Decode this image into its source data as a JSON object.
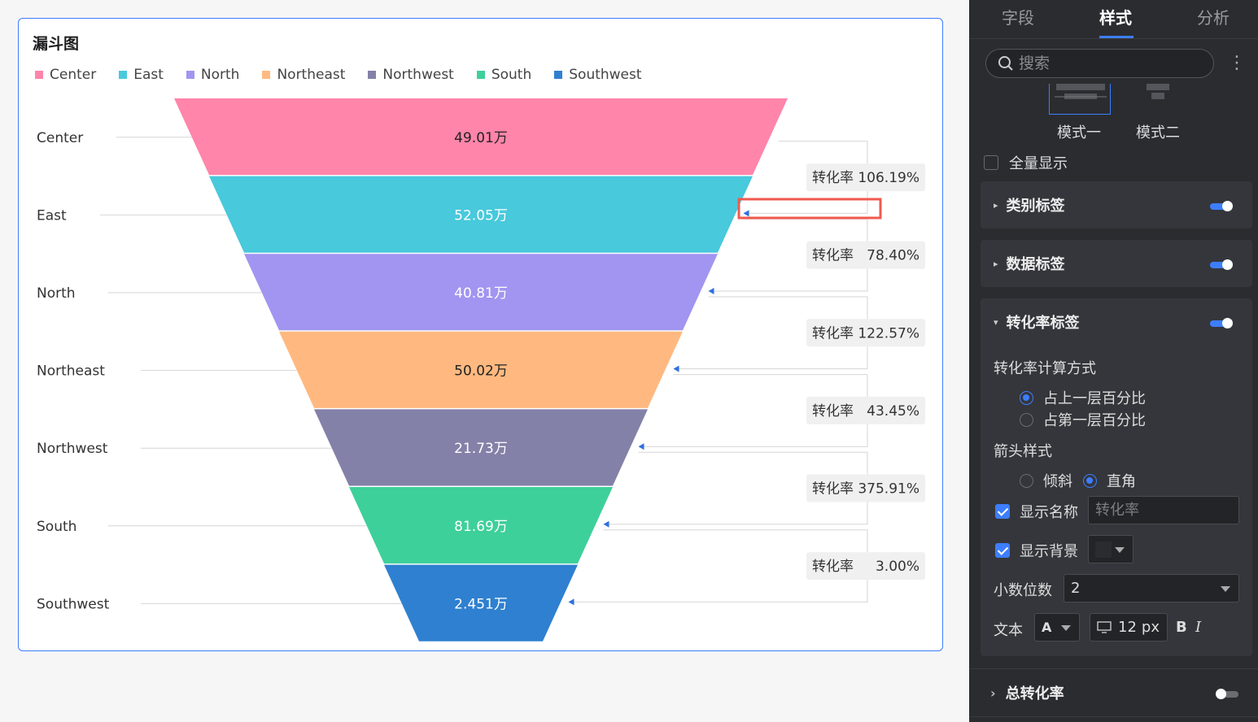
{
  "chart": {
    "title": "漏斗图",
    "legend": [
      {
        "label": "Center",
        "color": "#ff85aa"
      },
      {
        "label": "East",
        "color": "#48c9dc"
      },
      {
        "label": "North",
        "color": "#a195f1"
      },
      {
        "label": "Northeast",
        "color": "#ffb980"
      },
      {
        "label": "Northwest",
        "color": "#8381a8"
      },
      {
        "label": "South",
        "color": "#3ed09a"
      },
      {
        "label": "Southwest",
        "color": "#2f80d0"
      }
    ]
  },
  "chart_data": {
    "type": "funnel",
    "title": "漏斗图",
    "categories": [
      "Center",
      "East",
      "North",
      "Northeast",
      "Northwest",
      "South",
      "Southwest"
    ],
    "values": [
      49.01,
      52.05,
      40.81,
      50.02,
      21.73,
      81.69,
      2.451
    ],
    "value_unit": "万",
    "value_labels": [
      "49.01万",
      "52.05万",
      "40.81万",
      "50.02万",
      "21.73万",
      "81.69万",
      "2.451万"
    ],
    "conversion_label": "转化率",
    "conversion_rates": [
      "106.19%",
      "78.40%",
      "122.57%",
      "43.45%",
      "375.91%",
      "3.00%"
    ],
    "legend_position": "top-left"
  },
  "panel": {
    "tabs": [
      {
        "label": "字段",
        "active": false
      },
      {
        "label": "样式",
        "active": true
      },
      {
        "label": "分析",
        "active": false
      }
    ],
    "search_placeholder": "搜索",
    "mode_1": "模式一",
    "mode_2": "模式二",
    "full_display": "全量显示",
    "sections": {
      "category_label": "类别标签",
      "data_label": "数据标签",
      "conversion_label": "转化率标签",
      "total_conversion": "总转化率"
    },
    "calc_method_label": "转化率计算方式",
    "calc_options": [
      "占上一层百分比",
      "占第一层百分比"
    ],
    "calc_selected": 0,
    "arrow_style_label": "箭头样式",
    "arrow_options": [
      "倾斜",
      "直角"
    ],
    "arrow_selected": 1,
    "show_name_label": "显示名称",
    "show_name_placeholder": "转化率",
    "show_bg_label": "显示背景",
    "decimals_label": "小数位数",
    "decimals_value": "2",
    "text_label": "文本",
    "font_glyph": "A",
    "font_size": "12",
    "font_unit": "px",
    "bold_glyph": "B",
    "italic_glyph": "I"
  }
}
